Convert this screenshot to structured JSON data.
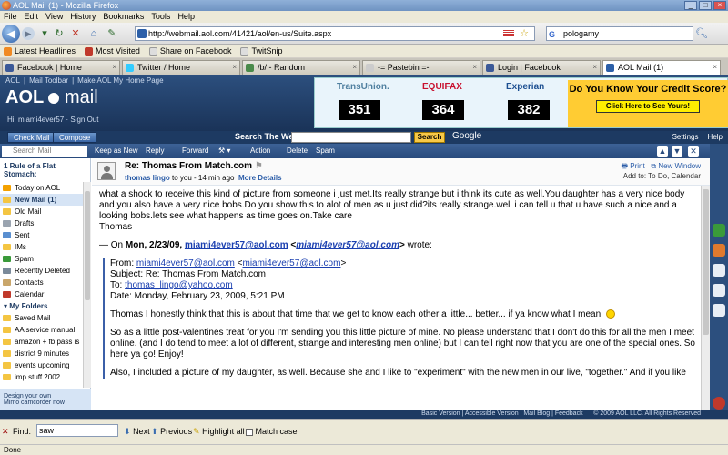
{
  "window": {
    "title": "AOL Mail (1) - Mozilla Firefox"
  },
  "menu": [
    "File",
    "Edit",
    "View",
    "History",
    "Bookmarks",
    "Tools",
    "Help"
  ],
  "address": {
    "url": "http://webmail.aol.com/41421/aol/en-us/Suite.aspx"
  },
  "browser_search": {
    "value": "pologamy"
  },
  "bookmarks": [
    "Latest Headlines",
    "Most Visited",
    "Share on Facebook",
    "TwitSnip"
  ],
  "tabs": [
    {
      "label": "Facebook | Home",
      "color": "#3b5998"
    },
    {
      "label": "Twitter / Home",
      "color": "#33ccff"
    },
    {
      "label": "/b/ - Random",
      "color": "#4a8a4a"
    },
    {
      "label": "-= Pastebin =-",
      "color": "#cccccc"
    },
    {
      "label": "Login | Facebook",
      "color": "#3b5998"
    },
    {
      "label": "AOL Mail (1)",
      "color": "#2c5fa8"
    }
  ],
  "aol": {
    "links": [
      "AOL",
      "Mail Toolbar",
      "Make AOL My Home Page"
    ],
    "logo_aol": "AOL",
    "logo_mail": "mail",
    "user": "Hi, miami4ever57  ·  Sign Out",
    "check_mail": "Check Mail",
    "compose": "Compose",
    "search_web_label": "Search The Web",
    "search_button": "Search",
    "enhanced_by": "Google",
    "settings": "Settings",
    "help": "Help"
  },
  "ad": {
    "credits": [
      {
        "name": "TransUnion.",
        "score": "351",
        "color": "#4f7f9f"
      },
      {
        "name": "EQUIFAX",
        "score": "364",
        "color": "#c8102e"
      },
      {
        "name": "Experian",
        "score": "382",
        "color": "#1d4f91"
      }
    ],
    "headline": "Do You Know Your Credit Score?",
    "cta": "Click Here to See Yours!"
  },
  "toolbar": {
    "search_placeholder": "Search Mail",
    "keep_as_new": "Keep as New",
    "reply": "Reply",
    "forward": "Forward",
    "action": "Action",
    "delete": "Delete",
    "spam": "Spam"
  },
  "sidebar": {
    "tip": "1 Rule of a Flat Stomach:",
    "items": [
      {
        "label": "Today on AOL",
        "color": "#f4a100"
      },
      {
        "label": "New Mail (1)",
        "color": "#f4c542",
        "selected": true
      },
      {
        "label": "Old Mail",
        "color": "#f4c542"
      },
      {
        "label": "Drafts",
        "color": "#9aa4b0"
      },
      {
        "label": "Sent",
        "color": "#5a8fd0"
      },
      {
        "label": "IMs",
        "color": "#f4c542"
      },
      {
        "label": "Spam",
        "color": "#3a9a3a"
      },
      {
        "label": "Recently Deleted",
        "color": "#7a8a9a"
      },
      {
        "label": "Contacts",
        "color": "#c9a66b"
      },
      {
        "label": "Calendar",
        "color": "#c0392b"
      }
    ],
    "my_folders_label": "My Folders",
    "my_folders": [
      {
        "label": "Saved Mail",
        "color": "#f4c542"
      },
      {
        "label": "AA service manual",
        "color": "#f4c542"
      },
      {
        "label": "amazon + fb pass is",
        "color": "#f4c542"
      },
      {
        "label": "district 9 minutes",
        "color": "#f4c542"
      },
      {
        "label": "events upcoming",
        "color": "#f4c542"
      },
      {
        "label": "imp stuff 2002",
        "color": "#f4c542"
      }
    ],
    "promo_line1": "Design your own",
    "promo_line2": "Mimo camcorder now"
  },
  "message": {
    "subject": "Re: Thomas From Match.com",
    "sender": "thomas lingo",
    "meta": "to you - 14 min ago",
    "more_details": "More Details",
    "print": "Print",
    "new_window": "New Window",
    "add_todo": "Add to: To Do, Calendar",
    "body_p1": "what a shock to receive this kind of picture from someone i just met.Its really strange but i think its cute as well.You daughter has a very nice body and you also have a very nice bobs.Do you show this to alot of men as u just did?its really strange.well i can tell u that u have such a nice and a looking bobs.lets see what happens as time goes on.Take care",
    "body_sign": "Thomas",
    "on_prefix": "— On",
    "on_date": "Mon, 2/23/09,",
    "on_email": "miami4ever57@aol.com",
    "on_email2": "miami4ever57@aol.com",
    "wrote": "wrote:",
    "q_from_label": "From:",
    "q_from": "miami4ever57@aol.com",
    "q_from2": "miami4ever57@aol.com",
    "q_subject": "Subject: Re: Thomas From Match.com",
    "q_to_label": "To:",
    "q_to": "thomas_lingo@yahoo.com",
    "q_date": "Date: Monday, February 23, 2009, 5:21 PM",
    "q_p1": "Thomas I honestly think that this is about that time that we get to know each other a little... better... if ya know what I mean.",
    "q_p2": "So as a little post-valentines treat for you I'm sending you this little picture of mine. No please understand that I don't do this for all the men I meet online. (and I do tend to meet a lot of different, strange and interesting men online) but I can tell right now that you are one of the special ones. So here ya go! Enjoy!",
    "q_p3": "Also, I included a picture of my daughter, as well. Because she and I like to \"experiment\" with the new men in our live, \"together.\" And if you like"
  },
  "footer": {
    "links": "Basic Version | Accessible Version | Mail Blog | Feedback",
    "copyright": "© 2009 AOL LLC. All Rights Reserved"
  },
  "find": {
    "label": "Find:",
    "value": "saw",
    "next": "Next",
    "previous": "Previous",
    "highlight": "Highlight all",
    "match_case": "Match case"
  },
  "status": {
    "text": "Done"
  }
}
